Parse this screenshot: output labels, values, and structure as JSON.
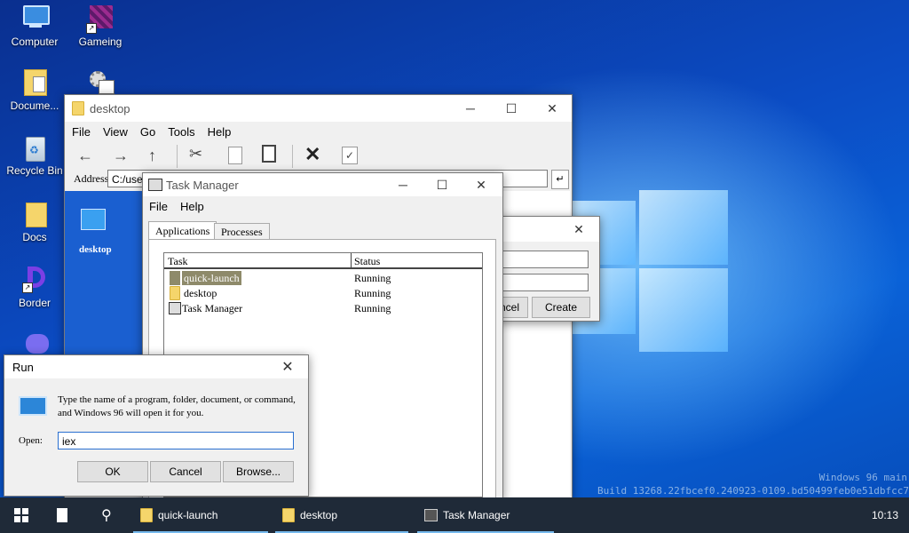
{
  "desktop": {
    "icons": [
      {
        "label": "Computer"
      },
      {
        "label": "Gameing"
      },
      {
        "label": "Docume..."
      },
      {
        "label": "Recycle Bin"
      },
      {
        "label": "Docs"
      },
      {
        "label": "Border"
      }
    ],
    "watermark": {
      "line1": "Windows 96 main",
      "line2": "Build 13268.22fbcef0.240923-0109.bd50499feb0e51dbfcc7"
    }
  },
  "explorer": {
    "title": "desktop",
    "menu": [
      "File",
      "View",
      "Go",
      "Tools",
      "Help"
    ],
    "address_label": "Address",
    "address_value": "C:/user",
    "item_label": "desktop"
  },
  "task_manager": {
    "title": "Task Manager",
    "menu": [
      "File",
      "Help"
    ],
    "tabs": [
      "Applications",
      "Processes"
    ],
    "columns": [
      "Task",
      "Status"
    ],
    "rows": [
      {
        "task": "quick-launch",
        "status": "Running"
      },
      {
        "task": "desktop",
        "status": "Running"
      },
      {
        "task": "Task Manager",
        "status": "Running"
      }
    ]
  },
  "behind_dialog": {
    "cancel_label": "ncel",
    "create_label": "Create"
  },
  "run_dialog": {
    "title": "Run",
    "description": "Type the name of a program, folder, document, or command, and Windows 96 will open it for you.",
    "open_label": "Open:",
    "open_value": "iex",
    "ok_label": "OK",
    "cancel_label": "Cancel",
    "browse_label": "Browse..."
  },
  "taskbar": {
    "items": [
      {
        "label": "quick-launch"
      },
      {
        "label": "desktop"
      },
      {
        "label": "Task Manager"
      }
    ],
    "clock": "10:13"
  },
  "colors": {
    "accent": "#0b4cc4",
    "taskbar": "#1f2a38",
    "selection": "#8e8a6a"
  }
}
